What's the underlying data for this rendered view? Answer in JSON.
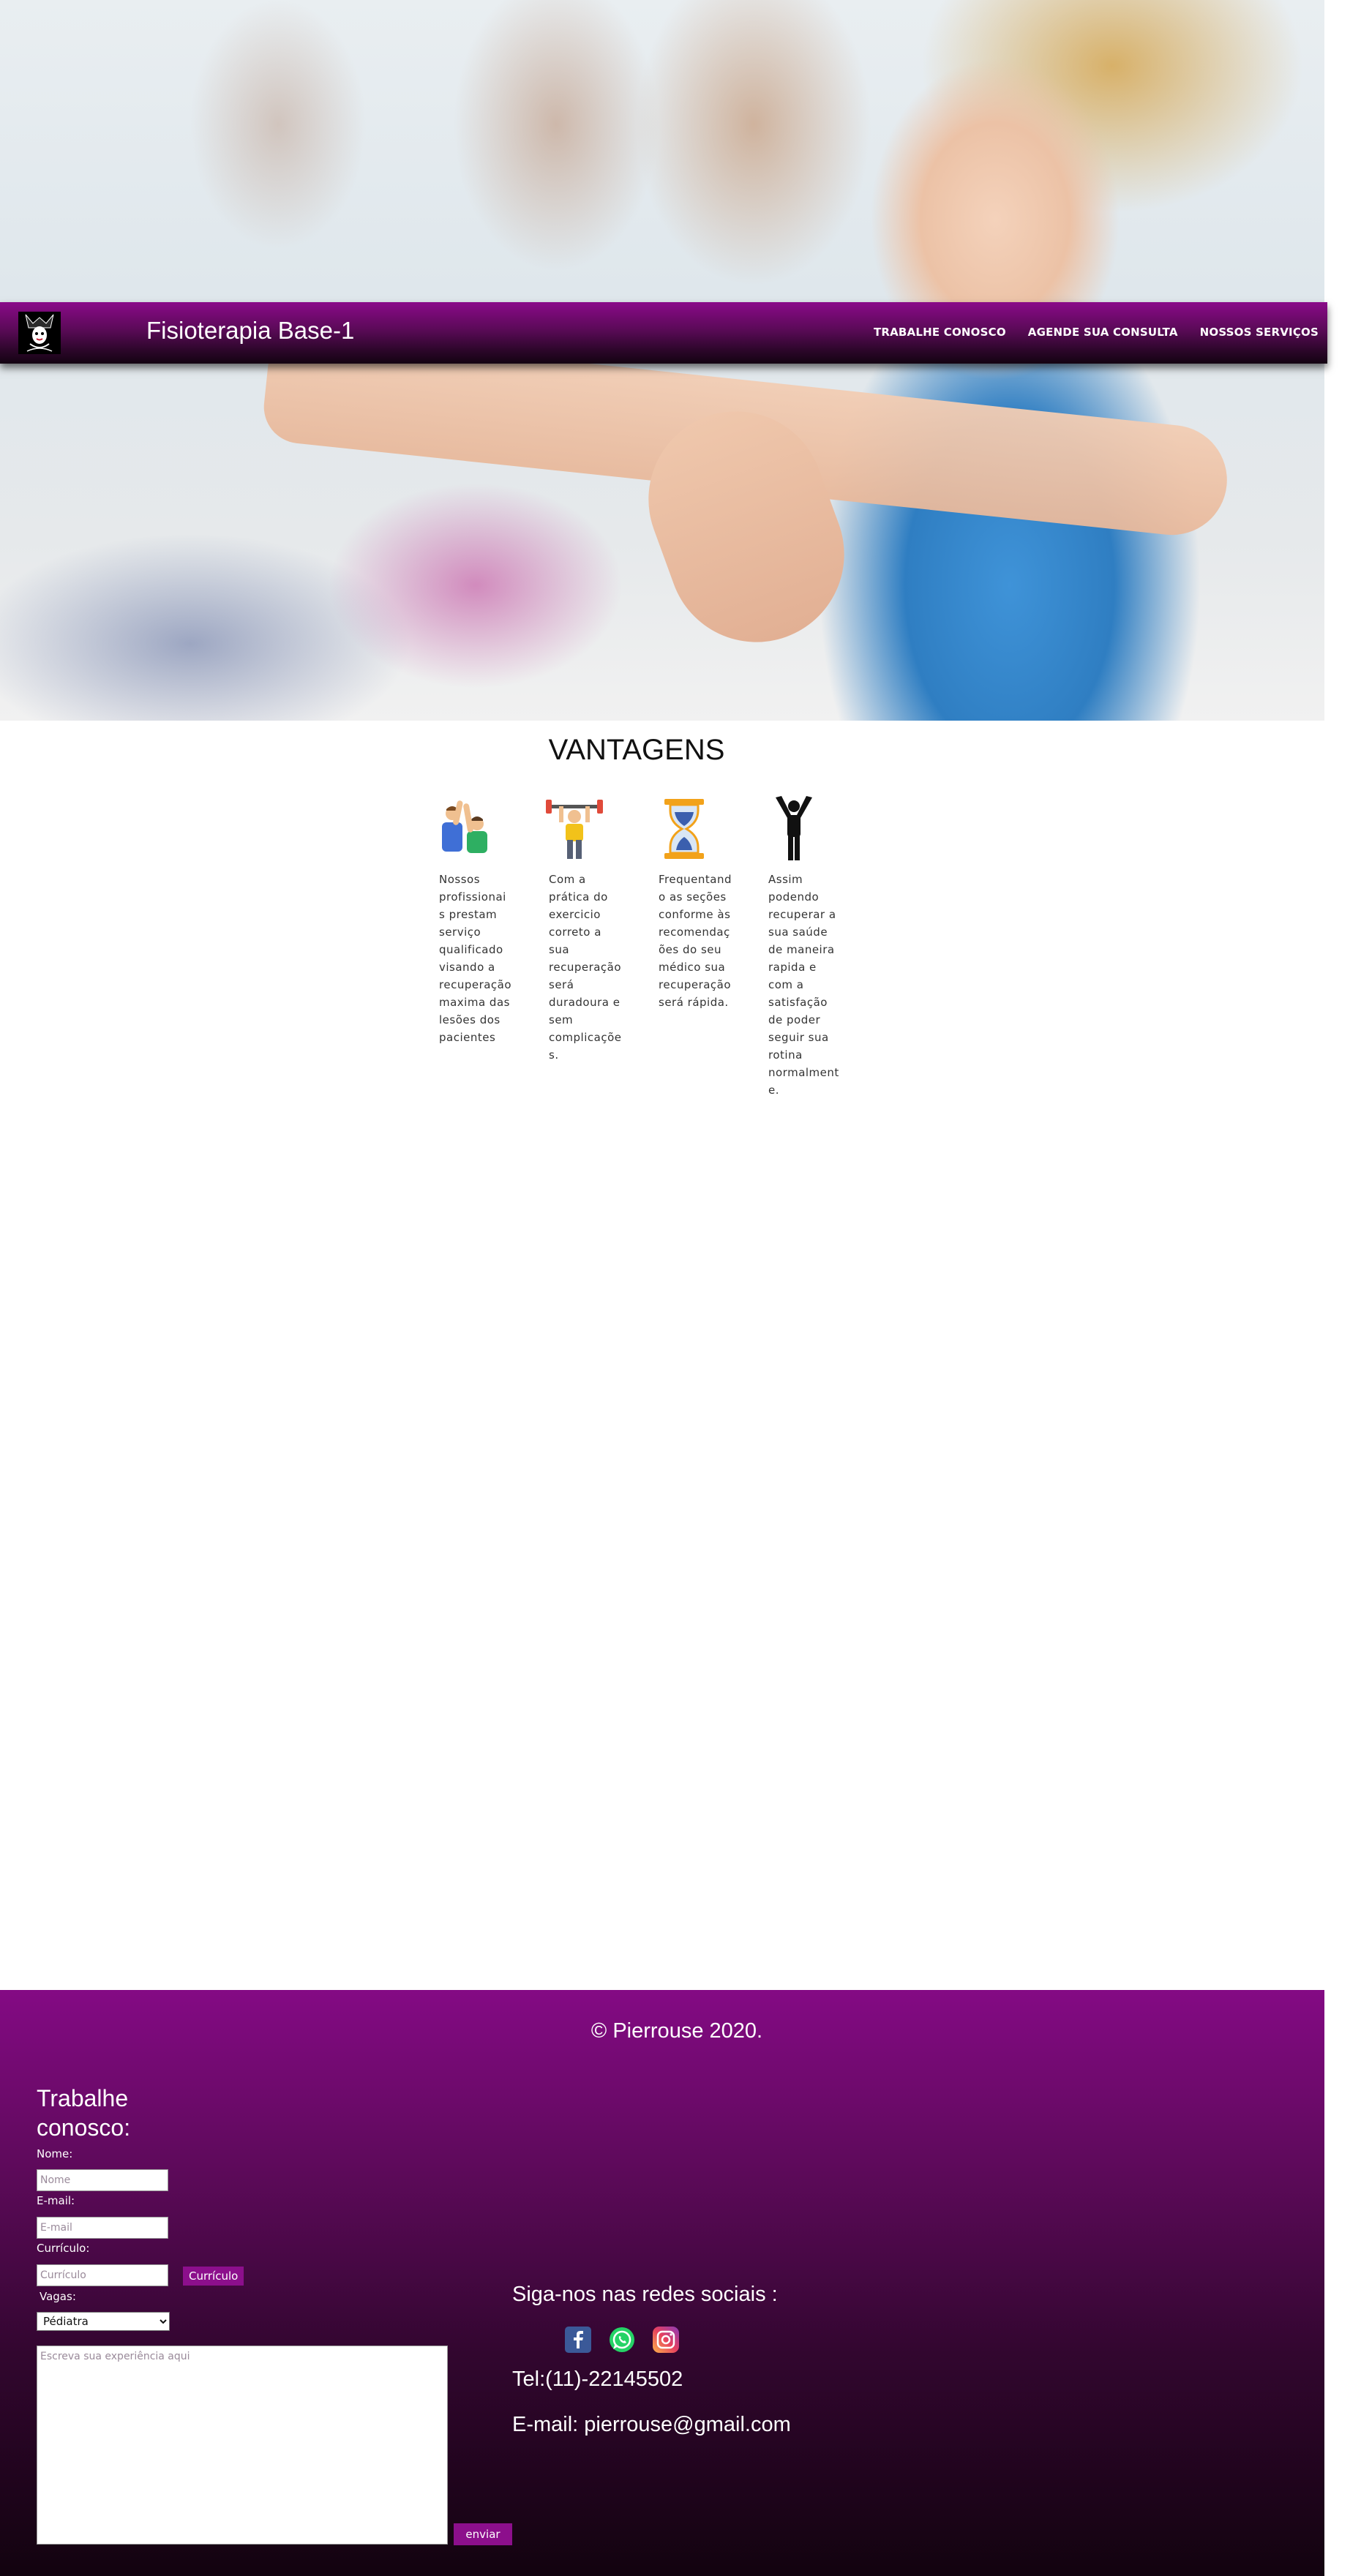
{
  "header": {
    "brand": "Fisioterapia Base-1",
    "nav": [
      {
        "label": "TRABALHE CONOSCO"
      },
      {
        "label": "AGENDE SUA CONSULTA"
      },
      {
        "label": "NOSSOS SERVIÇOS"
      }
    ]
  },
  "vantagens": {
    "title": "VANTAGENS",
    "items": [
      {
        "icon": "high-five-icon",
        "text": "Nossos profissionais prestam serviço qualificado visando a recuperação maxima das lesões dos pacientes"
      },
      {
        "icon": "weightlifter-icon",
        "text": "Com a prática do exercicio correto a sua recuperação será duradoura e sem complicações."
      },
      {
        "icon": "hourglass-icon",
        "text": "Frequentando as seções conforme às recomendações do seu médico sua recuperação será rápida."
      },
      {
        "icon": "celebrating-person-icon",
        "text": "Assim podendo recuperar a sua saúde de maneira rapida e com a satisfação de poder seguir sua rotina normalmente."
      }
    ]
  },
  "footer": {
    "copyright": "© Pierrouse 2020.",
    "form": {
      "title": "Trabalhe conosco:",
      "name_label": "Nome:",
      "name_placeholder": "Nome",
      "email_label": "E-mail:",
      "email_placeholder": "E-mail",
      "cv_label": "Currículo:",
      "cv_placeholder": "Currículo",
      "cv_button": "Currículo",
      "vagas_label": "Vagas:",
      "vagas_selected": "Pédiatra",
      "experience_placeholder": "Escreva sua experiência aqui",
      "submit": "enviar"
    },
    "social": {
      "title": "Siga-nos nas redes sociais :",
      "icons": [
        "facebook-icon",
        "whatsapp-icon",
        "instagram-icon"
      ]
    },
    "phone": "Tel:(11)-22145502",
    "email": "E-mail: pierrouse@gmail.com"
  },
  "colors": {
    "brand_purple": "#8a0a89",
    "dark_purple": "#140312",
    "button_purple": "#8c0f8c"
  }
}
